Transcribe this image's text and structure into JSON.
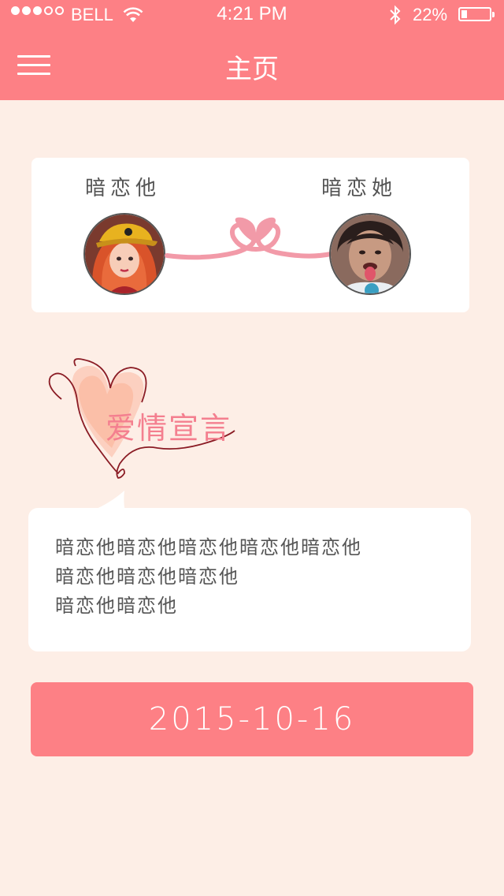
{
  "status_bar": {
    "carrier": "BELL",
    "time": "4:21 PM",
    "battery": "22%",
    "battery_level": 0.22,
    "signal_bars_filled": 3,
    "signal_bars_total": 5
  },
  "header": {
    "title": "主页"
  },
  "couple": {
    "him_label": "暗恋他",
    "her_label": "暗恋她"
  },
  "declaration": {
    "title": "爱情宣言",
    "lines": [
      "暗恋他暗恋他暗恋他暗恋他暗恋他",
      "暗恋他暗恋他暗恋他",
      "暗恋他暗恋他"
    ]
  },
  "date_button": {
    "label": "2015-10-16"
  },
  "colors": {
    "accent": "#fd8085",
    "background": "#fdeee6",
    "card": "#ffffff",
    "text": "#555555",
    "title_pink": "#f47f8f"
  }
}
